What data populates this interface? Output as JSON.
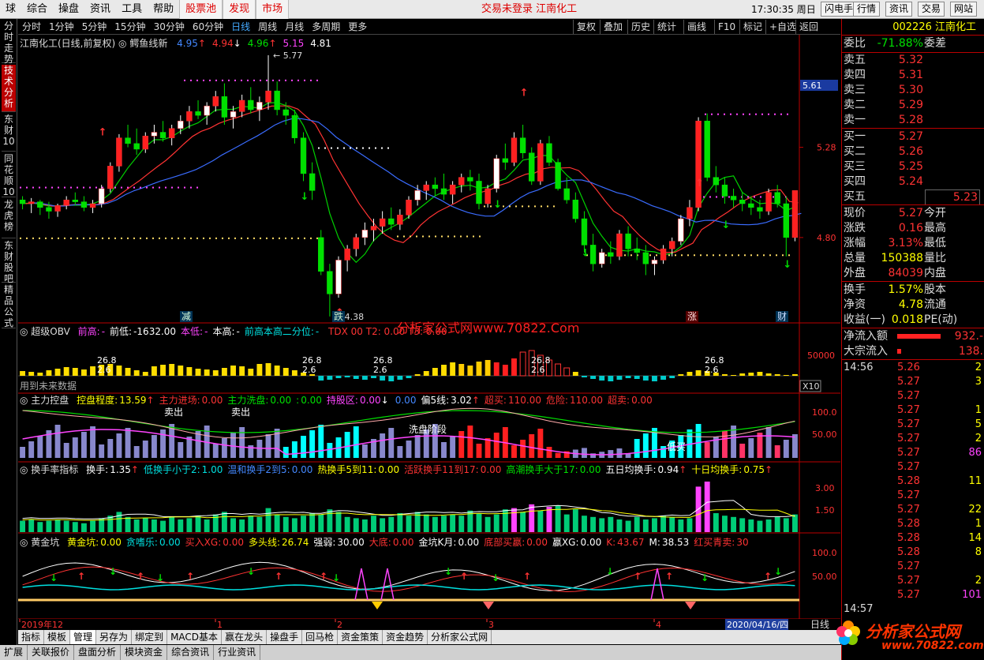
{
  "menu": {
    "items": [
      "球",
      "综合",
      "操盘",
      "资讯",
      "工具",
      "帮助"
    ],
    "highlight_items": [
      "股票池",
      "发现",
      "市场"
    ],
    "status_title": "交易未登录  江南化工",
    "clock": "17:30:35 周日",
    "right_buttons": [
      "闪电手",
      "行情",
      "资讯",
      "交易",
      "网站"
    ]
  },
  "left_tabs": [
    {
      "label": "分时走势",
      "active": false
    },
    {
      "label": "技术分析",
      "active": true
    },
    {
      "label": "东财10",
      "active": false
    },
    {
      "label": "同花顺10",
      "active": false
    },
    {
      "label": "龙虎榜",
      "active": false
    },
    {
      "label": "东财股吧",
      "active": false
    },
    {
      "label": "精品公式",
      "active": false
    }
  ],
  "period_bar": {
    "periods": [
      "分时",
      "1分钟",
      "5分钟",
      "15分钟",
      "30分钟",
      "60分钟",
      "日线",
      "周线",
      "月线",
      "多周期",
      "更多"
    ],
    "active": "日线",
    "tools": [
      "复权",
      "叠加",
      "历史",
      "统计",
      "画线",
      "F10",
      "标记",
      "+自选",
      "返回"
    ]
  },
  "main_chart": {
    "title": "江南化工(日线,前复权)",
    "indicator": "鳄鱼线新",
    "params": [
      {
        "name": "鄂:",
        "value": "4.95",
        "color": "#4488ff",
        "arrow": "↑"
      },
      {
        "name": "齿:",
        "value": "4.94",
        "color": "#ff3333",
        "arrow": "↓"
      },
      {
        "name": "唇:",
        "value": "4.96",
        "color": "#00e000",
        "arrow": "↑"
      },
      {
        "name": "上分形:",
        "value": "5.15",
        "color": "#ff44ff",
        "arrow": ""
      },
      {
        "name": "下分形:",
        "value": "4.81",
        "color": "#ffffff",
        "arrow": ""
      }
    ],
    "high_label": "5.77",
    "low_label": "4.38",
    "price_ticks": [
      "5.61",
      "5.28",
      "4.80"
    ],
    "event_labels": [
      "减",
      "跌",
      "涨",
      "财"
    ],
    "watermark": "分析家公式网www.70822.Com"
  },
  "chart_data": {
    "type": "candlestick",
    "ylim": [
      4.35,
      5.82
    ],
    "candles": [
      [
        5.0,
        5.02,
        4.95,
        4.98
      ],
      [
        4.98,
        5.01,
        4.93,
        4.99
      ],
      [
        4.99,
        5.0,
        4.92,
        4.96
      ],
      [
        4.96,
        4.99,
        4.9,
        4.94
      ],
      [
        4.94,
        4.98,
        4.91,
        4.97
      ],
      [
        4.97,
        5.02,
        4.95,
        5.0
      ],
      [
        5.0,
        5.04,
        4.97,
        4.99
      ],
      [
        4.99,
        5.02,
        4.94,
        4.96
      ],
      [
        4.96,
        5.0,
        4.93,
        4.98
      ],
      [
        4.98,
        5.08,
        4.96,
        5.06
      ],
      [
        5.06,
        5.2,
        5.04,
        5.18
      ],
      [
        5.18,
        5.35,
        5.15,
        5.33
      ],
      [
        5.33,
        5.4,
        5.28,
        5.3
      ],
      [
        5.3,
        5.38,
        5.24,
        5.27
      ],
      [
        5.27,
        5.36,
        5.25,
        5.34
      ],
      [
        5.34,
        5.4,
        5.3,
        5.36
      ],
      [
        5.36,
        5.42,
        5.31,
        5.33
      ],
      [
        5.33,
        5.4,
        5.29,
        5.38
      ],
      [
        5.38,
        5.45,
        5.35,
        5.42
      ],
      [
        5.42,
        5.5,
        5.38,
        5.47
      ],
      [
        5.47,
        5.53,
        5.43,
        5.45
      ],
      [
        5.45,
        5.52,
        5.4,
        5.5
      ],
      [
        5.5,
        5.58,
        5.47,
        5.55
      ],
      [
        5.55,
        5.62,
        5.4,
        5.44
      ],
      [
        5.44,
        5.5,
        5.38,
        5.47
      ],
      [
        5.47,
        5.56,
        5.44,
        5.53
      ],
      [
        5.53,
        5.6,
        5.46,
        5.48
      ],
      [
        5.48,
        5.55,
        5.42,
        5.52
      ],
      [
        5.52,
        5.77,
        5.48,
        5.58
      ],
      [
        5.58,
        5.63,
        5.45,
        5.48
      ],
      [
        5.48,
        5.52,
        5.4,
        5.45
      ],
      [
        5.45,
        5.48,
        5.3,
        5.33
      ],
      [
        5.33,
        5.36,
        5.1,
        5.14
      ],
      [
        5.14,
        5.2,
        5.0,
        5.05
      ],
      [
        4.8,
        4.84,
        4.6,
        4.62
      ],
      [
        4.62,
        4.66,
        4.38,
        4.5
      ],
      [
        4.5,
        4.7,
        4.48,
        4.68
      ],
      [
        4.68,
        4.76,
        4.62,
        4.74
      ],
      [
        4.74,
        4.82,
        4.7,
        4.8
      ],
      [
        4.8,
        4.88,
        4.76,
        4.84
      ],
      [
        4.84,
        4.9,
        4.78,
        4.86
      ],
      [
        4.86,
        4.94,
        4.82,
        4.9
      ],
      [
        4.9,
        4.96,
        4.84,
        4.87
      ],
      [
        4.87,
        4.95,
        4.84,
        4.92
      ],
      [
        4.92,
        5.02,
        4.9,
        5.0
      ],
      [
        5.0,
        5.08,
        4.97,
        5.05
      ],
      [
        5.05,
        5.1,
        5.0,
        5.08
      ],
      [
        5.08,
        5.12,
        5.02,
        5.06
      ],
      [
        5.06,
        5.14,
        5.0,
        5.03
      ],
      [
        5.03,
        5.1,
        4.98,
        5.08
      ],
      [
        5.08,
        5.14,
        5.04,
        5.12
      ],
      [
        5.12,
        5.16,
        5.05,
        5.1
      ],
      [
        5.1,
        5.14,
        4.95,
        4.98
      ],
      [
        4.98,
        5.08,
        4.96,
        5.06
      ],
      [
        5.06,
        5.24,
        5.04,
        5.22
      ],
      [
        5.22,
        5.3,
        5.16,
        5.2
      ],
      [
        5.2,
        5.36,
        5.18,
        5.33
      ],
      [
        5.33,
        5.4,
        5.22,
        5.25
      ],
      [
        5.25,
        5.28,
        5.08,
        5.1
      ],
      [
        5.1,
        5.32,
        5.08,
        5.3
      ],
      [
        5.3,
        5.34,
        5.18,
        5.2
      ],
      [
        5.2,
        5.22,
        5.05,
        5.06
      ],
      [
        5.06,
        5.12,
        4.98,
        5.0
      ],
      [
        5.0,
        5.04,
        4.88,
        4.9
      ],
      [
        4.9,
        4.94,
        4.72,
        4.76
      ],
      [
        4.76,
        4.82,
        4.62,
        4.66
      ],
      [
        4.66,
        4.74,
        4.64,
        4.72
      ],
      [
        4.72,
        4.78,
        4.66,
        4.7
      ],
      [
        4.7,
        4.84,
        4.68,
        4.82
      ],
      [
        4.82,
        4.86,
        4.7,
        4.74
      ],
      [
        4.74,
        4.8,
        4.68,
        4.72
      ],
      [
        4.72,
        4.76,
        4.6,
        4.66
      ],
      [
        4.66,
        4.7,
        4.6,
        4.68
      ],
      [
        4.68,
        4.76,
        4.66,
        4.74
      ],
      [
        4.74,
        4.8,
        4.7,
        4.78
      ],
      [
        4.78,
        4.92,
        4.76,
        4.9
      ],
      [
        4.9,
        5.0,
        4.86,
        4.96
      ],
      [
        4.96,
        5.44,
        4.94,
        5.42
      ],
      [
        5.42,
        5.46,
        5.1,
        5.12
      ],
      [
        5.12,
        5.18,
        5.04,
        5.08
      ],
      [
        5.08,
        5.12,
        4.98,
        5.02
      ],
      [
        5.02,
        5.06,
        4.96,
        5.0
      ],
      [
        5.0,
        5.04,
        4.94,
        4.98
      ],
      [
        4.98,
        5.02,
        4.92,
        4.96
      ],
      [
        4.96,
        5.0,
        4.9,
        4.94
      ],
      [
        4.94,
        5.06,
        4.92,
        5.04
      ],
      [
        5.04,
        5.08,
        4.96,
        4.98
      ],
      [
        4.98,
        5.02,
        4.7,
        4.8
      ],
      [
        4.8,
        4.96,
        4.78,
        5.05
      ]
    ],
    "obv_values": [
      12,
      10,
      8,
      14,
      18,
      22,
      20,
      16,
      24,
      28,
      30,
      26,
      20,
      14,
      10,
      24,
      28,
      30,
      26,
      22,
      18,
      16,
      14,
      20,
      26,
      24,
      18,
      30,
      32,
      26,
      20,
      14,
      8,
      4,
      -12,
      -10,
      -6,
      -4,
      -8,
      -10,
      -6,
      -12,
      -14,
      -10,
      -6,
      4,
      12,
      20,
      28,
      34,
      30,
      26,
      36,
      40,
      34,
      28,
      44,
      60,
      64,
      52,
      40,
      30,
      20,
      10,
      -4,
      -8,
      -12,
      -14,
      -10,
      -6,
      -8,
      -12,
      -14,
      -10,
      -6,
      4,
      10,
      14,
      12,
      8,
      4,
      2,
      6,
      8,
      10,
      6,
      4,
      2,
      4
    ],
    "turnover_values": [
      0.9,
      1.0,
      0.8,
      0.9,
      1.0,
      0.9,
      0.8,
      0.7,
      0.9,
      1.1,
      1.3,
      1.6,
      1.2,
      1.0,
      1.1,
      1.0,
      0.9,
      1.2,
      1.0,
      1.1,
      1.3,
      1.0,
      1.4,
      1.6,
      1.1,
      1.0,
      1.3,
      1.2,
      1.9,
      1.4,
      1.2,
      1.1,
      1.3,
      1.5,
      1.4,
      1.8,
      1.6,
      1.2,
      1.1,
      1.0,
      1.3,
      1.1,
      1.2,
      1.5,
      1.3,
      1.6,
      1.4,
      1.2,
      1.3,
      1.4,
      1.3,
      1.7,
      1.5,
      1.2,
      1.4,
      1.8,
      1.9,
      1.6,
      2.2,
      1.7,
      2.0,
      2.1,
      1.4,
      1.8,
      1.3,
      1.2,
      1.1,
      1.2,
      1.0,
      0.9,
      1.2,
      1.0,
      1.1,
      1.3,
      1.2,
      1.0,
      1.1,
      3.6,
      4.0,
      1.5,
      1.3,
      1.2,
      1.1,
      1.0,
      0.9,
      1.0,
      1.2,
      1.1,
      1.4
    ]
  },
  "obv_panel": {
    "title": "超级OBV",
    "fields": [
      {
        "label": "前高:",
        "value": "-",
        "color": "#ff44ff"
      },
      {
        "label": "前低:",
        "value": "-1632.00",
        "color": "#ffffff"
      },
      {
        "label": "本低:",
        "value": "-",
        "color": "#ff44ff"
      },
      {
        "label": "本高:",
        "value": "-",
        "color": "#ffffff"
      },
      {
        "label": "前高本高二分位:",
        "value": "-",
        "color": "#00e0e0"
      }
    ],
    "tail": "TDX    00  T2: 0.00  T3: 0.00",
    "labels": [
      "26.8",
      "2.6",
      "26.8",
      "2.6",
      "26.8",
      "2.6",
      "26.8",
      "2.6",
      "26.8",
      "2.6"
    ],
    "tick": "50000",
    "unit": "X10",
    "note": "用到未来数据"
  },
  "mf_panel": {
    "title": "主力控盘",
    "fields": [
      {
        "label": "控盘程度:",
        "value": "13.59",
        "color": "#ffff00",
        "arrow": "↑"
      },
      {
        "label": "主力进场:",
        "value": "0.00",
        "color": "#ff3333",
        "arrow": ""
      },
      {
        "label": "主力洗盘:",
        "value": "0.00",
        "color": "#00e000",
        "arrow": ""
      },
      {
        "label": ":",
        "value": "0.00",
        "color": "#00e000",
        "arrow": ""
      },
      {
        "label": "持股区:",
        "value": "0.00",
        "color": "#ff44ff",
        "arrow": "↓"
      },
      {
        "label": "",
        "value": "0.00",
        "color": "#4488ff",
        "arrow": ""
      },
      {
        "label": "偏5线:",
        "value": "3.02",
        "color": "#ffffff",
        "arrow": "↑"
      },
      {
        "label": "超买:",
        "value": "110.00",
        "color": "#ff3333",
        "arrow": ""
      },
      {
        "label": "危险:",
        "value": "110.00",
        "color": "#ff3333",
        "arrow": ""
      },
      {
        "label": "超卖:",
        "value": "0.00",
        "color": "#ff3333",
        "arrow": ""
      }
    ],
    "annotations": [
      "卖出",
      "卖出",
      "洗盘阶段",
      "低买"
    ],
    "ticks": [
      "100.0",
      "50.00"
    ]
  },
  "turnover_panel": {
    "title": "换手率指标",
    "fields": [
      {
        "label": "换手:",
        "value": "1.35",
        "color": "#ffffff",
        "arrow": "↑"
      },
      {
        "label": "低换手小于2:",
        "value": "1.00",
        "color": "#00e0e0",
        "arrow": ""
      },
      {
        "label": "温和换手2到5:",
        "value": "0.00",
        "color": "#4488ff",
        "arrow": ""
      },
      {
        "label": "热换手5到11:",
        "value": "0.00",
        "color": "#ffff00",
        "arrow": ""
      },
      {
        "label": "活跃换手11到17:",
        "value": "0.00",
        "color": "#ff3333",
        "arrow": ""
      },
      {
        "label": "高潮换手大于17:",
        "value": "0.00",
        "color": "#00e000",
        "arrow": ""
      },
      {
        "label": "五日均换手:",
        "value": "0.94",
        "color": "#ffffff",
        "arrow": "↑"
      },
      {
        "label": "十日均换手:",
        "value": "0.75",
        "color": "#ffff00",
        "arrow": "↑"
      }
    ],
    "ticks": [
      "3.00",
      "1.50"
    ]
  },
  "gold_panel": {
    "title": "黄金坑",
    "fields": [
      {
        "label": "黄金坑:",
        "value": "0.00",
        "color": "#ffff00"
      },
      {
        "label": "贪嗜乐:",
        "value": "0.00",
        "color": "#00e0e0"
      },
      {
        "label": "买入XG:",
        "value": "0.00",
        "color": "#ff3333"
      },
      {
        "label": "多头线:",
        "value": "26.74",
        "color": "#ffff00"
      },
      {
        "label": "强弱:",
        "value": "30.00",
        "color": "#ffffff"
      },
      {
        "label": "大底:",
        "value": "0.00",
        "color": "#ff3333"
      },
      {
        "label": "金坑K月:",
        "value": "0.00",
        "color": "#ffffff"
      },
      {
        "label": "底部买嬴:",
        "value": "0.00",
        "color": "#ff3333"
      },
      {
        "label": "嬴XG:",
        "value": "0.00",
        "color": "#ffffff"
      },
      {
        "label": "K:",
        "value": "43.67",
        "color": "#ff3333"
      },
      {
        "label": "M:",
        "value": "38.53",
        "color": "#ffffff"
      },
      {
        "label": "红买青卖:",
        "value": "30",
        "color": "#ff3333"
      }
    ],
    "ticks": [
      "100.0",
      "50.00"
    ]
  },
  "x_axis": {
    "labels": [
      "2019年12",
      "1",
      "2",
      "3",
      "4"
    ],
    "cursor_date": "2020/04/16/四",
    "right": "日线"
  },
  "bottom_tabs": [
    "指标",
    "模板",
    "管理",
    "另存为",
    "绑定到",
    "MACD基本",
    "赢在龙头",
    "操盘手",
    "回马枪",
    "资金策策",
    "资金趋势",
    "分析家公式网"
  ],
  "bottom_tabs_active": "管理",
  "bottom_tabs2": [
    "扩展",
    "关联报价",
    "盘面分析",
    "模块资金",
    "综合资讯",
    "行业资讯"
  ],
  "right_panel": {
    "code": "002226 江南化工",
    "weibi": {
      "label": "委比",
      "value": "-71.88%",
      "label2": "委差"
    },
    "asks": [
      {
        "label": "卖五",
        "price": "5.32"
      },
      {
        "label": "卖四",
        "price": "5.31"
      },
      {
        "label": "卖三",
        "price": "5.30"
      },
      {
        "label": "卖二",
        "price": "5.29"
      },
      {
        "label": "卖一",
        "price": "5.28"
      }
    ],
    "bids": [
      {
        "label": "买一",
        "price": "5.27"
      },
      {
        "label": "买二",
        "price": "5.26"
      },
      {
        "label": "买三",
        "price": "5.25"
      },
      {
        "label": "买四",
        "price": "5.24"
      },
      {
        "label": "买五",
        "price": "5.23"
      }
    ],
    "stats": [
      {
        "l1": "现价",
        "v1": "5.27",
        "c1": "#ff3333",
        "l2": "今开",
        "v2": ""
      },
      {
        "l1": "涨跌",
        "v1": "0.16",
        "c1": "#ff3333",
        "l2": "最高",
        "v2": ""
      },
      {
        "l1": "涨幅",
        "v1": "3.13%",
        "c1": "#ff3333",
        "l2": "最低",
        "v2": ""
      },
      {
        "l1": "总量",
        "v1": "150388",
        "c1": "#ffff00",
        "l2": "量比",
        "v2": ""
      },
      {
        "l1": "外盘",
        "v1": "84039",
        "c1": "#ff3333",
        "l2": "内盘",
        "v2": ""
      },
      {
        "l1": "换手",
        "v1": "1.57%",
        "c1": "#ffff00",
        "l2": "股本",
        "v2": ""
      },
      {
        "l1": "净资",
        "v1": "4.78",
        "c1": "#ffff00",
        "l2": "流通",
        "v2": ""
      },
      {
        "l1": "收益(一)",
        "v1": "0.018",
        "c1": "#ffff00",
        "l2": "PE(动)",
        "v2": ""
      }
    ],
    "flow": [
      {
        "label": "净流入额",
        "value": "932.-",
        "bar": 0.55
      },
      {
        "label": "大宗流入",
        "value": "138.",
        "bar": 0.05
      }
    ],
    "ticks": [
      {
        "t": "14:56",
        "p": "5.26",
        "v": "2"
      },
      {
        "t": "",
        "p": "5.27",
        "v": "3"
      },
      {
        "t": "",
        "p": "5.27",
        "v": ""
      },
      {
        "t": "",
        "p": "5.27",
        "v": "1"
      },
      {
        "t": "",
        "p": "5.27",
        "v": "5"
      },
      {
        "t": "",
        "p": "5.27",
        "v": "2"
      },
      {
        "t": "",
        "p": "5.27",
        "v": "86"
      },
      {
        "t": "",
        "p": "5.27",
        "v": ""
      },
      {
        "t": "",
        "p": "5.28",
        "v": "11"
      },
      {
        "t": "",
        "p": "5.27",
        "v": ""
      },
      {
        "t": "",
        "p": "5.27",
        "v": "22"
      },
      {
        "t": "",
        "p": "5.28",
        "v": "1"
      },
      {
        "t": "",
        "p": "5.28",
        "v": "14"
      },
      {
        "t": "",
        "p": "5.28",
        "v": "8"
      },
      {
        "t": "",
        "p": "5.27",
        "v": ""
      },
      {
        "t": "",
        "p": "5.27",
        "v": "2"
      },
      {
        "t": "",
        "p": "5.27",
        "v": "101"
      },
      {
        "t": "14:57",
        "p": "",
        "v": ""
      }
    ]
  },
  "site_watermark": "分析家公式网",
  "site_url": "www.70822.com"
}
